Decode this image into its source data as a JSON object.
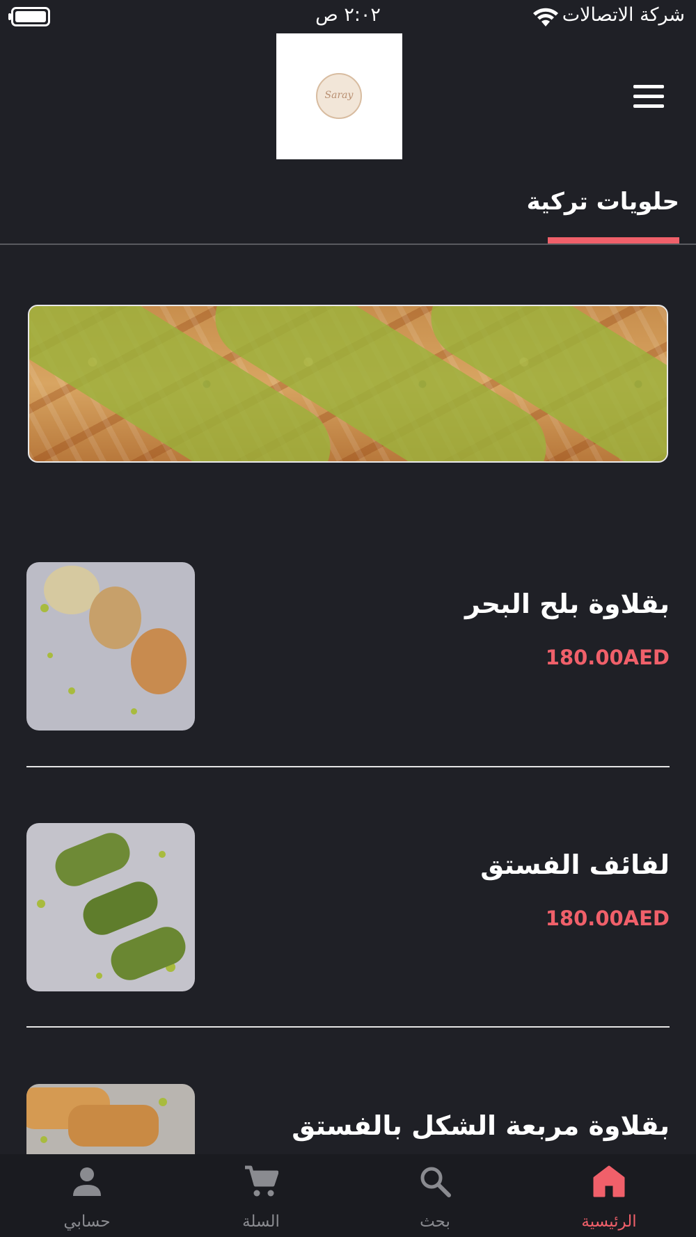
{
  "status_bar": {
    "time": "٢:٠٢ ص",
    "carrier": "شركة الاتصالات"
  },
  "header": {
    "logo_text": "Saray"
  },
  "tabs": [
    {
      "label": "حلويات تركية",
      "active": true
    }
  ],
  "products": [
    {
      "name": "بقلاوة بلح البحر",
      "price": "180.00AED"
    },
    {
      "name": "لفائف الفستق",
      "price": "180.00AED"
    },
    {
      "name": "بقلاوة مربعة الشكل بالفستق",
      "price": ""
    }
  ],
  "bottom_nav": [
    {
      "label": "الرئيسية",
      "icon": "home-icon",
      "active": true
    },
    {
      "label": "بحث",
      "icon": "search-icon",
      "active": false
    },
    {
      "label": "السلة",
      "icon": "cart-icon",
      "active": false
    },
    {
      "label": "حسابي",
      "icon": "person-icon",
      "active": false
    }
  ],
  "colors": {
    "background": "#1f2026",
    "accent": "#f0606a",
    "nav_background": "#1a1b20",
    "nav_inactive": "#8a8b90"
  }
}
